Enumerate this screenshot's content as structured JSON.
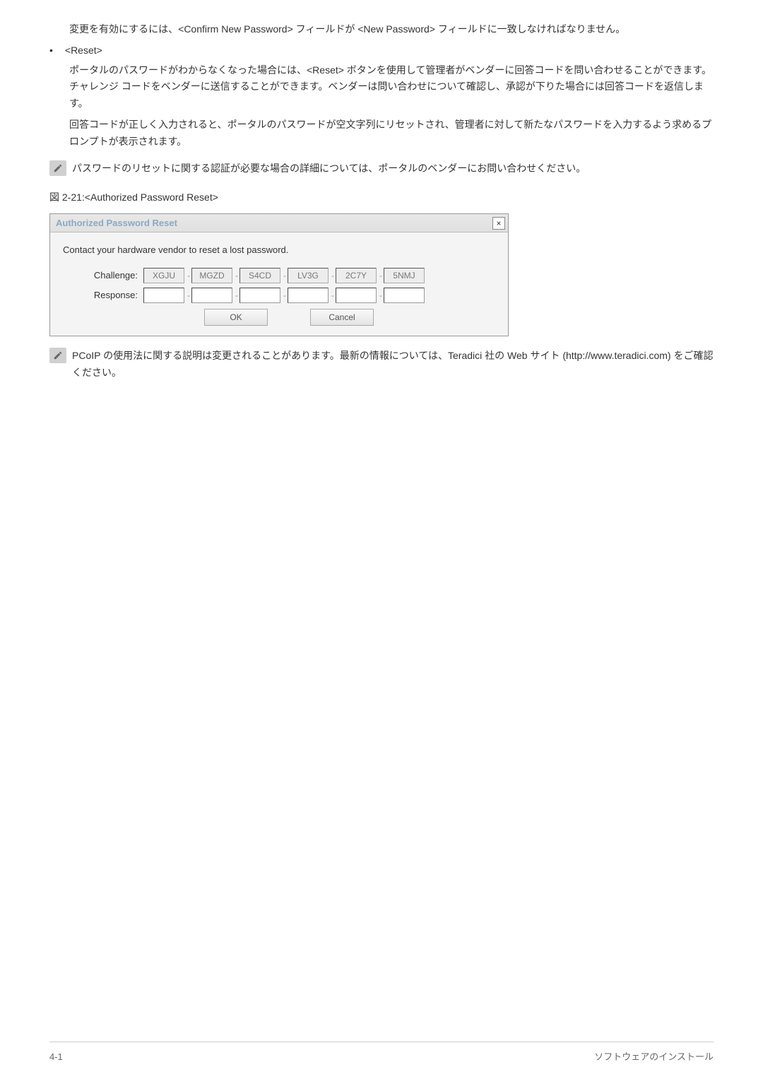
{
  "paragraph1": "変更を有効にするには、<Confirm New Password> フィールドが <New Password> フィールドに一致しなければなりません。",
  "bullet_label": "<Reset>",
  "paragraph2a": "ポータルのパスワードがわからなくなった場合には、<Reset> ボタンを使用して管理者がベンダーに回答コードを問い合わせることができます。チャレンジ コードをベンダーに送信することができます。ベンダーは問い合わせについて確認し、承認が下りた場合には回答コードを返信します。",
  "paragraph2b": "回答コードが正しく入力されると、ポータルのパスワードが空文字列にリセットされ、管理者に対して新たなパスワードを入力するよう求めるプロンプトが表示されます。",
  "note1": "パスワードのリセットに関する認証が必要な場合の詳細については、ポータルのベンダーにお問い合わせください。",
  "figure_caption": "図 2-21:<Authorized Password Reset>",
  "dialog": {
    "title": "Authorized Password Reset",
    "instruction": "Contact your hardware vendor to reset a lost password.",
    "challenge_label": "Challenge:",
    "response_label": "Response:",
    "challenge_codes": [
      "XGJU",
      "MGZD",
      "S4CD",
      "LV3G",
      "2C7Y",
      "5NMJ"
    ],
    "ok_label": "OK",
    "cancel_label": "Cancel"
  },
  "note2": "PCoIP の使用法に関する説明は変更されることがあります。最新の情報については、Teradici 社の Web サイト (http://www.teradici.com) をご確認ください。",
  "footer_left": "4-1",
  "footer_right": "ソフトウェアのインストール"
}
